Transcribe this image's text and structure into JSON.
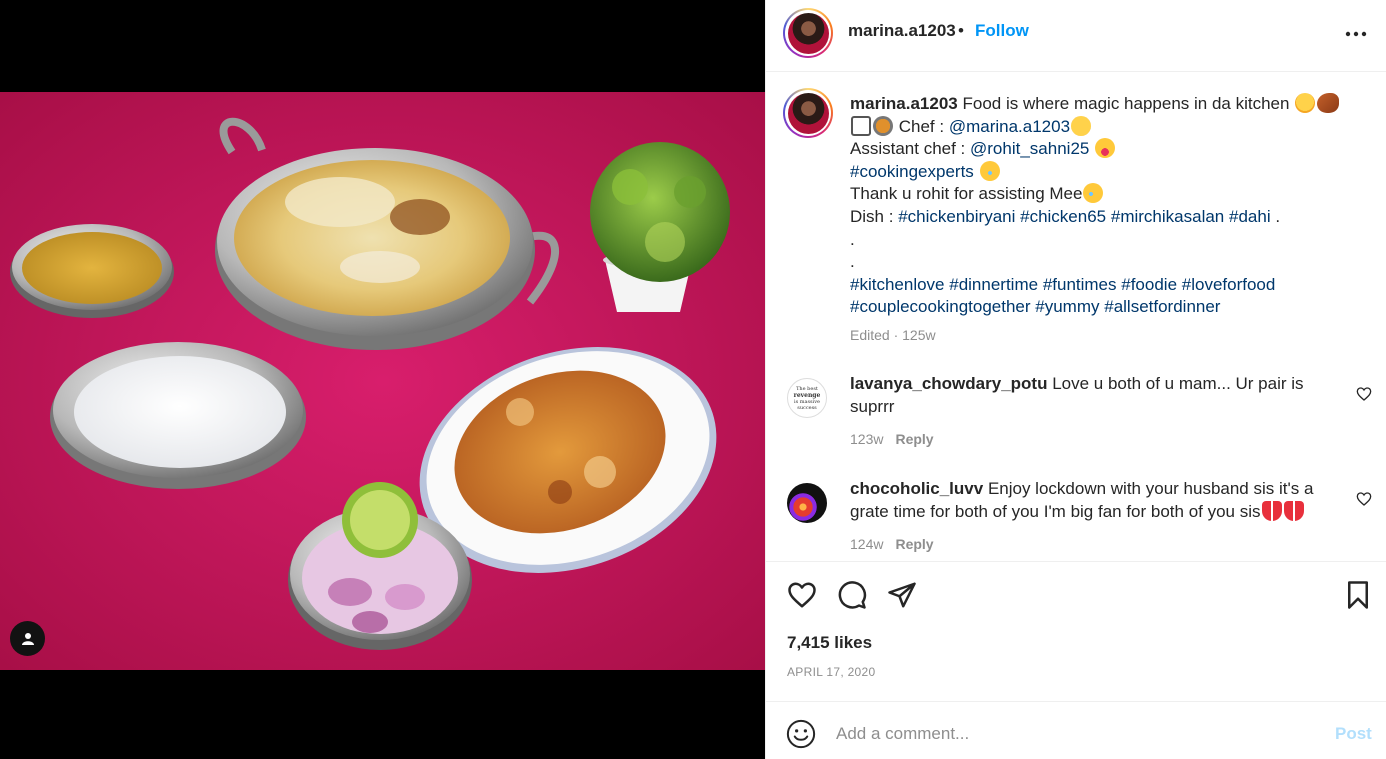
{
  "post": {
    "username": "marina.a1203",
    "follow_label": "Follow",
    "separator": "•",
    "more_icon": "more-horizontal-icon"
  },
  "caption": {
    "username": "marina.a1203",
    "line1_text": "Food is where magic happens in da kitchen",
    "line2_text": "Chef :",
    "line2_mention": "@marina.a1203",
    "line3_text": "Assistant chef :",
    "line3_mention": "@rohit_sahni25",
    "line4_hashtag": "#cookingexperts",
    "line5_text": "Thank u rohit for assisting Mee",
    "line6_text": "Dish :",
    "line6_hashtags": [
      "#chickenbiryani",
      "#chicken65",
      "#mirchikasalan",
      "#dahi"
    ],
    "line6_suffix": ".",
    "dot1": ".",
    "dot2": ".",
    "line9_hashtags": [
      "#kitchenlove",
      "#dinnertime",
      "#funtimes",
      "#foodie",
      "#loveforfood"
    ],
    "line10_hashtags": [
      "#couplecookingtogether",
      "#yummy",
      "#allsetfordinner"
    ],
    "edited": "Edited · 125w"
  },
  "comments": [
    {
      "username": "lavanya_chowdary_potu",
      "text_line1": "Love u both of u mam... Ur pair is",
      "text_line2": "suprrr",
      "time": "123w",
      "reply_label": "Reply",
      "avatar_text": [
        "The best",
        "revenge",
        "is massive",
        "success"
      ]
    },
    {
      "username": "chocoholic_luvv",
      "text_line1": "Enjoy lockdown with your husband sis it's a",
      "text_line2": "grate time for both of you I'm big fan for both of you sis",
      "time": "124w",
      "reply_label": "Reply"
    }
  ],
  "actions": {
    "likes": "7,415 likes",
    "date": "APRIL 17, 2020",
    "icons": [
      "heart-icon",
      "comment-icon",
      "share-icon",
      "bookmark-icon"
    ]
  },
  "add_comment": {
    "placeholder": "Add a comment...",
    "post_label": "Post"
  },
  "colors": {
    "follow_blue": "#0095f6",
    "link_navy": "#00376b",
    "post_disabled": "#b2dffc",
    "muted": "#8e8e8e",
    "tablecloth": "#c8175c"
  }
}
